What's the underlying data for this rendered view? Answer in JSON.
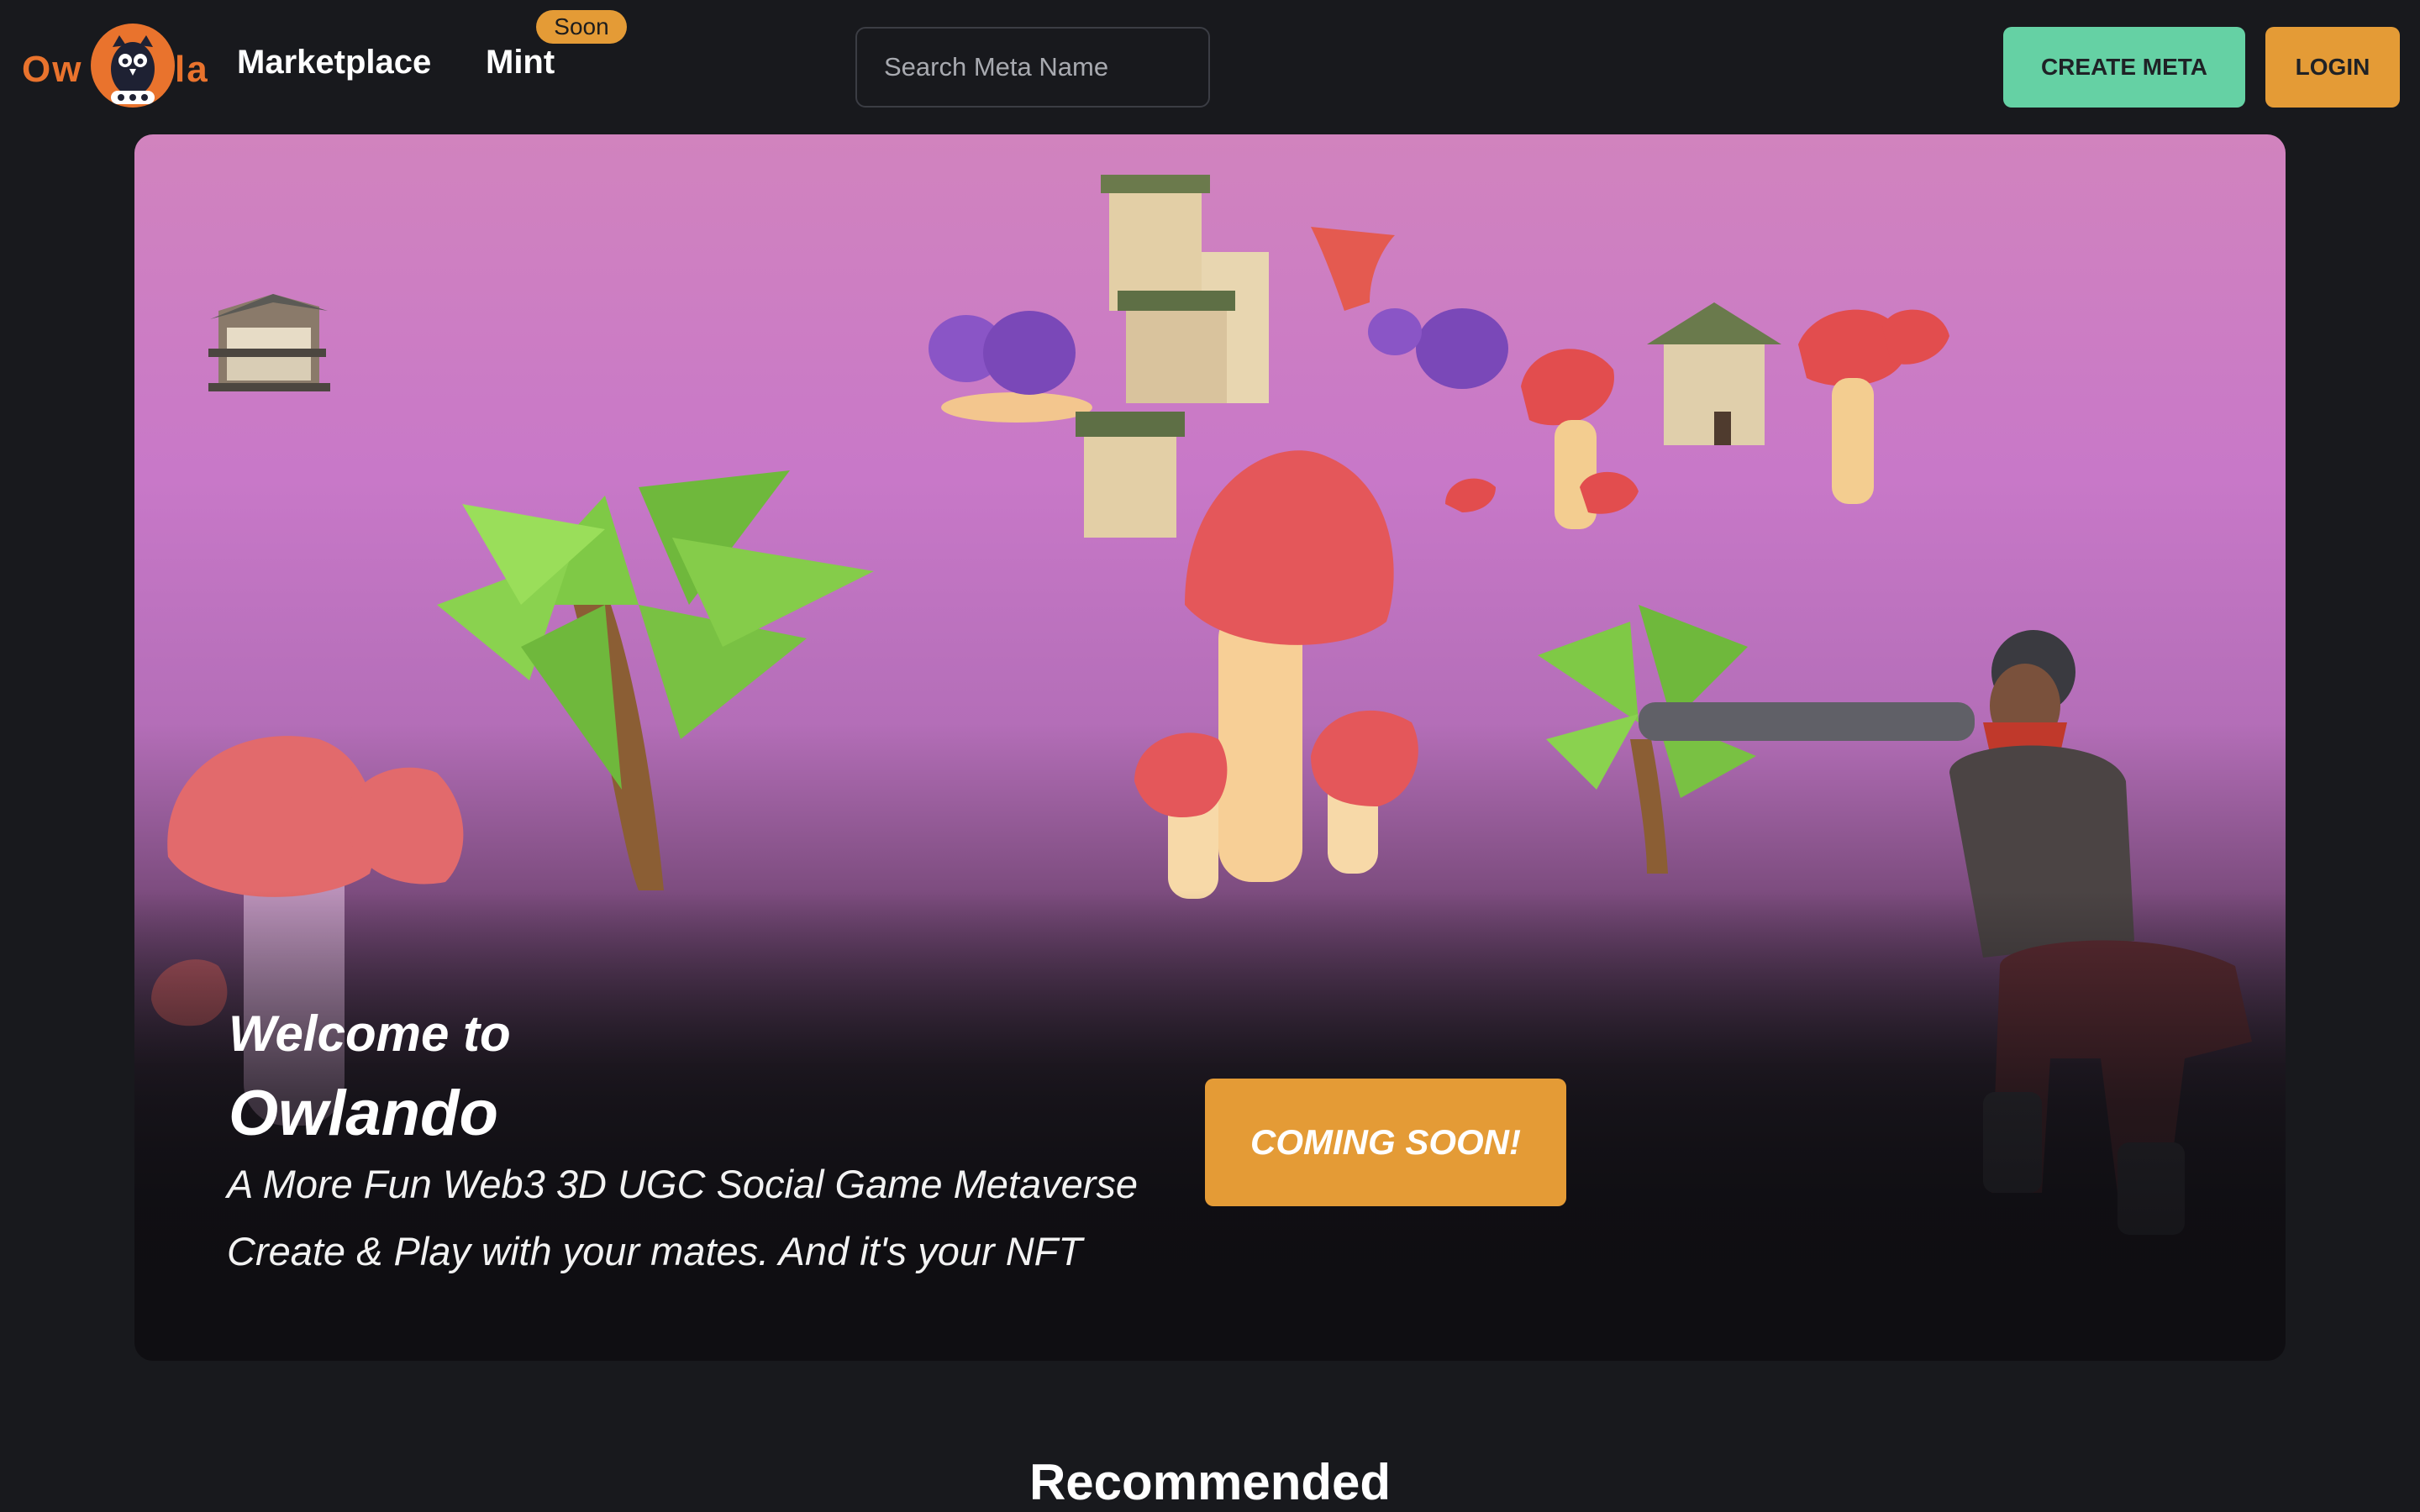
{
  "header": {
    "logo": {
      "left_text": "Ow",
      "right_text": "la"
    },
    "nav": [
      {
        "label": "Marketplace"
      },
      {
        "label": "Mint",
        "badge": "Soon"
      }
    ],
    "search": {
      "placeholder": "Search Meta Name",
      "value": ""
    },
    "create_label": "CREATE META",
    "login_label": "LOGIN"
  },
  "hero": {
    "welcome": "Welcome to",
    "title": "Owlando",
    "subtitle_1": "A More Fun Web3 3D UGC Social Game Metaverse",
    "subtitle_2": "Create & Play with your mates. And it's your NFT",
    "cta_label": "COMING SOON!"
  },
  "sections": {
    "recommended_title": "Recommended"
  },
  "colors": {
    "background": "#18191d",
    "brand_orange": "#e9732d",
    "accent_orange": "#e49b36",
    "accent_green": "#65d1a4",
    "hero_pink": "#d183be",
    "hero_purple": "#c878c8"
  },
  "icons": [
    "owl-logo-icon"
  ]
}
